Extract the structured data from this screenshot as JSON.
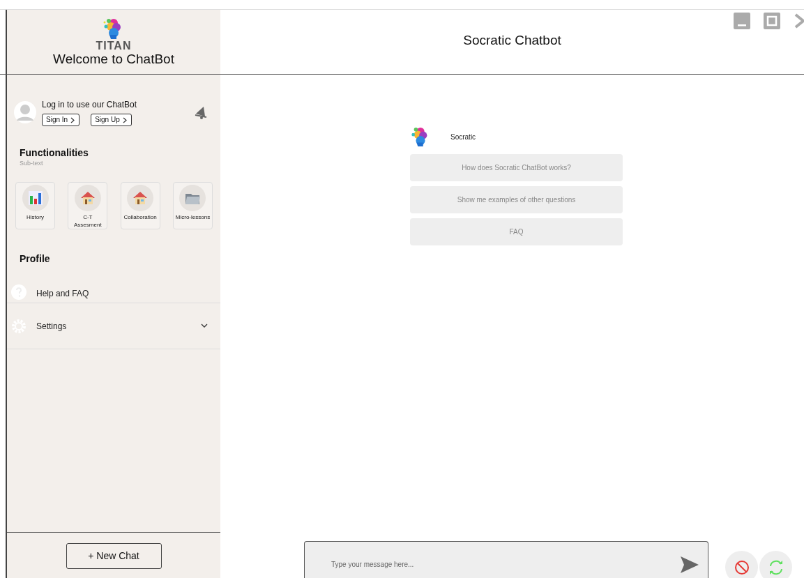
{
  "sidebar": {
    "brand": "TITAN",
    "title": "Welcome to ChatBot",
    "login": {
      "prompt": "Log in to use our ChatBot",
      "buttons": [
        {
          "label": "Sign In"
        },
        {
          "label": "Sign Up"
        }
      ]
    },
    "functionalities": {
      "heading": "Functionalities",
      "subtext": "Sub-text",
      "tiles": [
        {
          "label": "History",
          "kind": "chart"
        },
        {
          "label": "C-T Assesment",
          "kind": "house"
        },
        {
          "label": "Collaboration",
          "kind": "house"
        },
        {
          "label": "Micro-lessons",
          "kind": "folder"
        }
      ]
    },
    "profile": {
      "heading": "Profile",
      "items": [
        {
          "label": "Help and FAQ",
          "kind": "help"
        },
        {
          "label": "Settings",
          "kind": "settings",
          "expanded": false
        }
      ]
    },
    "new_chat": "+ New Chat"
  },
  "main": {
    "title": "Socratic Chatbot",
    "bot_name": "Socratic",
    "suggestions": [
      "How does Socratic ChatBot works?",
      "Show me examples of other questions",
      "FAQ"
    ],
    "input": {
      "placeholder": "Type your message here..."
    }
  }
}
